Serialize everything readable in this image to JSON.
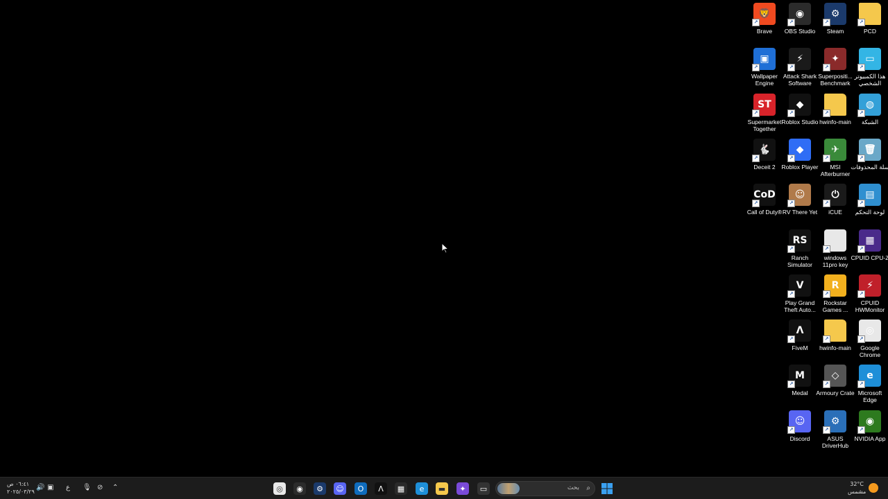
{
  "desktop": {
    "icons": [
      {
        "label": "Brave",
        "icon": "brave-icon",
        "color": "#f04a20",
        "glyph": "🦁"
      },
      {
        "label": "OBS Studio",
        "icon": "obs-icon",
        "color": "#2b2b2b",
        "glyph": "◉"
      },
      {
        "label": "Steam",
        "icon": "steam-icon",
        "color": "#1b3a6b",
        "glyph": "⚙"
      },
      {
        "label": "PCD",
        "icon": "folder-icon",
        "color": "#f5c84c",
        "glyph": ""
      },
      {
        "label": "Wallpaper Engine",
        "icon": "wallpaper-engine-icon",
        "color": "#1f6fd6",
        "glyph": "▣"
      },
      {
        "label": "Attack Shark Software",
        "icon": "attack-shark-icon",
        "color": "#1a1a1a",
        "glyph": "⚡"
      },
      {
        "label": "Superpositi... Benchmark",
        "icon": "superposition-icon",
        "color": "#8a2a2a",
        "glyph": "✦"
      },
      {
        "label": "هذا الكمبيوتر الشخصي",
        "icon": "this-pc-icon",
        "color": "#33b5e5",
        "glyph": "▭"
      },
      {
        "label": "Supermarket Together",
        "icon": "supermarket-together-icon",
        "color": "#d8232a",
        "glyph": "ST"
      },
      {
        "label": "Roblox Studio",
        "icon": "roblox-studio-icon",
        "color": "#111",
        "glyph": "◆"
      },
      {
        "label": "hwinfo-main",
        "icon": "folder-icon",
        "color": "#f5c84c",
        "glyph": ""
      },
      {
        "label": "الشبكة",
        "icon": "network-icon",
        "color": "#33a0d8",
        "glyph": "◍"
      },
      {
        "label": "Deceit 2",
        "icon": "deceit-icon",
        "color": "#111",
        "glyph": "🐇"
      },
      {
        "label": "Roblox Player",
        "icon": "roblox-player-icon",
        "color": "#2f6df5",
        "glyph": "◆"
      },
      {
        "label": "MSI Afterburner",
        "icon": "msi-afterburner-icon",
        "color": "#3a8a3a",
        "glyph": "✈"
      },
      {
        "label": "سلة المحذوفات",
        "icon": "recycle-bin-icon",
        "color": "#6aa8c8",
        "glyph": "🗑"
      },
      {
        "label": "Call of Duty®",
        "icon": "call-of-duty-icon",
        "color": "#111",
        "glyph": "CoD"
      },
      {
        "label": "RV There Yet",
        "icon": "rv-there-yet-icon",
        "color": "#b07a4a",
        "glyph": "☺"
      },
      {
        "label": "iCUE",
        "icon": "icue-icon",
        "color": "#1a1a1a",
        "glyph": "⏻"
      },
      {
        "label": "لوحة التحكم",
        "icon": "control-panel-icon",
        "color": "#2f8fd0",
        "glyph": "▤"
      },
      {
        "label": "Ranch Simulator",
        "icon": "ranch-simulator-icon",
        "color": "#111",
        "glyph": "RS"
      },
      {
        "label": "windows 11pro key",
        "icon": "text-file-icon",
        "color": "#e8e8e8",
        "glyph": ""
      },
      {
        "label": "CPUID CPU-Z",
        "icon": "cpu-z-icon",
        "color": "#4a2a8a",
        "glyph": "▦"
      },
      {
        "label": "Play Grand Theft Auto...",
        "icon": "gta-icon",
        "color": "#111",
        "glyph": "V"
      },
      {
        "label": "Rockstar Games ...",
        "icon": "rockstar-icon",
        "color": "#f2b01e",
        "glyph": "R"
      },
      {
        "label": "CPUID HWMonitor",
        "icon": "hwmonitor-icon",
        "color": "#c0202a",
        "glyph": "⚡"
      },
      {
        "label": "FiveM",
        "icon": "fivem-icon",
        "color": "#111",
        "glyph": "Λ"
      },
      {
        "label": "hwinfo-main",
        "icon": "folder-icon",
        "color": "#f5c84c",
        "glyph": ""
      },
      {
        "label": "Google Chrome",
        "icon": "chrome-icon",
        "color": "#e8e8e8",
        "glyph": "◎"
      },
      {
        "label": "Medal",
        "icon": "medal-icon",
        "color": "#111",
        "glyph": "M"
      },
      {
        "label": "Armoury Crate",
        "icon": "armoury-crate-icon",
        "color": "#555",
        "glyph": "◇"
      },
      {
        "label": "Microsoft Edge",
        "icon": "edge-icon",
        "color": "#1e8fd8",
        "glyph": "e"
      },
      {
        "label": "Discord",
        "icon": "discord-icon",
        "color": "#5865f2",
        "glyph": "☺"
      },
      {
        "label": "ASUS DriverHub",
        "icon": "asus-driverhub-icon",
        "color": "#2a6fb8",
        "glyph": "⚙"
      },
      {
        "label": "NVIDIA App",
        "icon": "nvidia-app-icon",
        "color": "#2d7a1e",
        "glyph": "◉"
      }
    ]
  },
  "taskbar": {
    "clock": {
      "time": "٠٦:٤١ ص",
      "date": "٢٠٢٥/٠٣/٢٩"
    },
    "language": "ع",
    "search_placeholder": "بحث",
    "weather": {
      "temp": "32°C",
      "condition": "مشمس"
    },
    "apps": [
      {
        "name": "chrome-taskbar-icon",
        "color": "#e8e8e8",
        "glyph": "◎"
      },
      {
        "name": "obs-taskbar-icon",
        "color": "#2b2b2b",
        "glyph": "◉"
      },
      {
        "name": "steam-taskbar-icon",
        "color": "#1b3a6b",
        "glyph": "⚙"
      },
      {
        "name": "discord-taskbar-icon",
        "color": "#5865f2",
        "glyph": "☺"
      },
      {
        "name": "outlook-taskbar-icon",
        "color": "#0f6cbd",
        "glyph": "O"
      },
      {
        "name": "fivem-taskbar-icon",
        "color": "#111",
        "glyph": "Λ"
      },
      {
        "name": "store-taskbar-icon",
        "color": "#2a2a2a",
        "glyph": "▦"
      },
      {
        "name": "edge-taskbar-icon",
        "color": "#1e8fd8",
        "glyph": "e"
      },
      {
        "name": "file-explorer-taskbar-icon",
        "color": "#f5c84c",
        "glyph": "▬"
      },
      {
        "name": "copilot-taskbar-icon",
        "color": "#7a4ad8",
        "glyph": "✦"
      },
      {
        "name": "task-view-taskbar-icon",
        "color": "#333",
        "glyph": "▭"
      }
    ]
  }
}
